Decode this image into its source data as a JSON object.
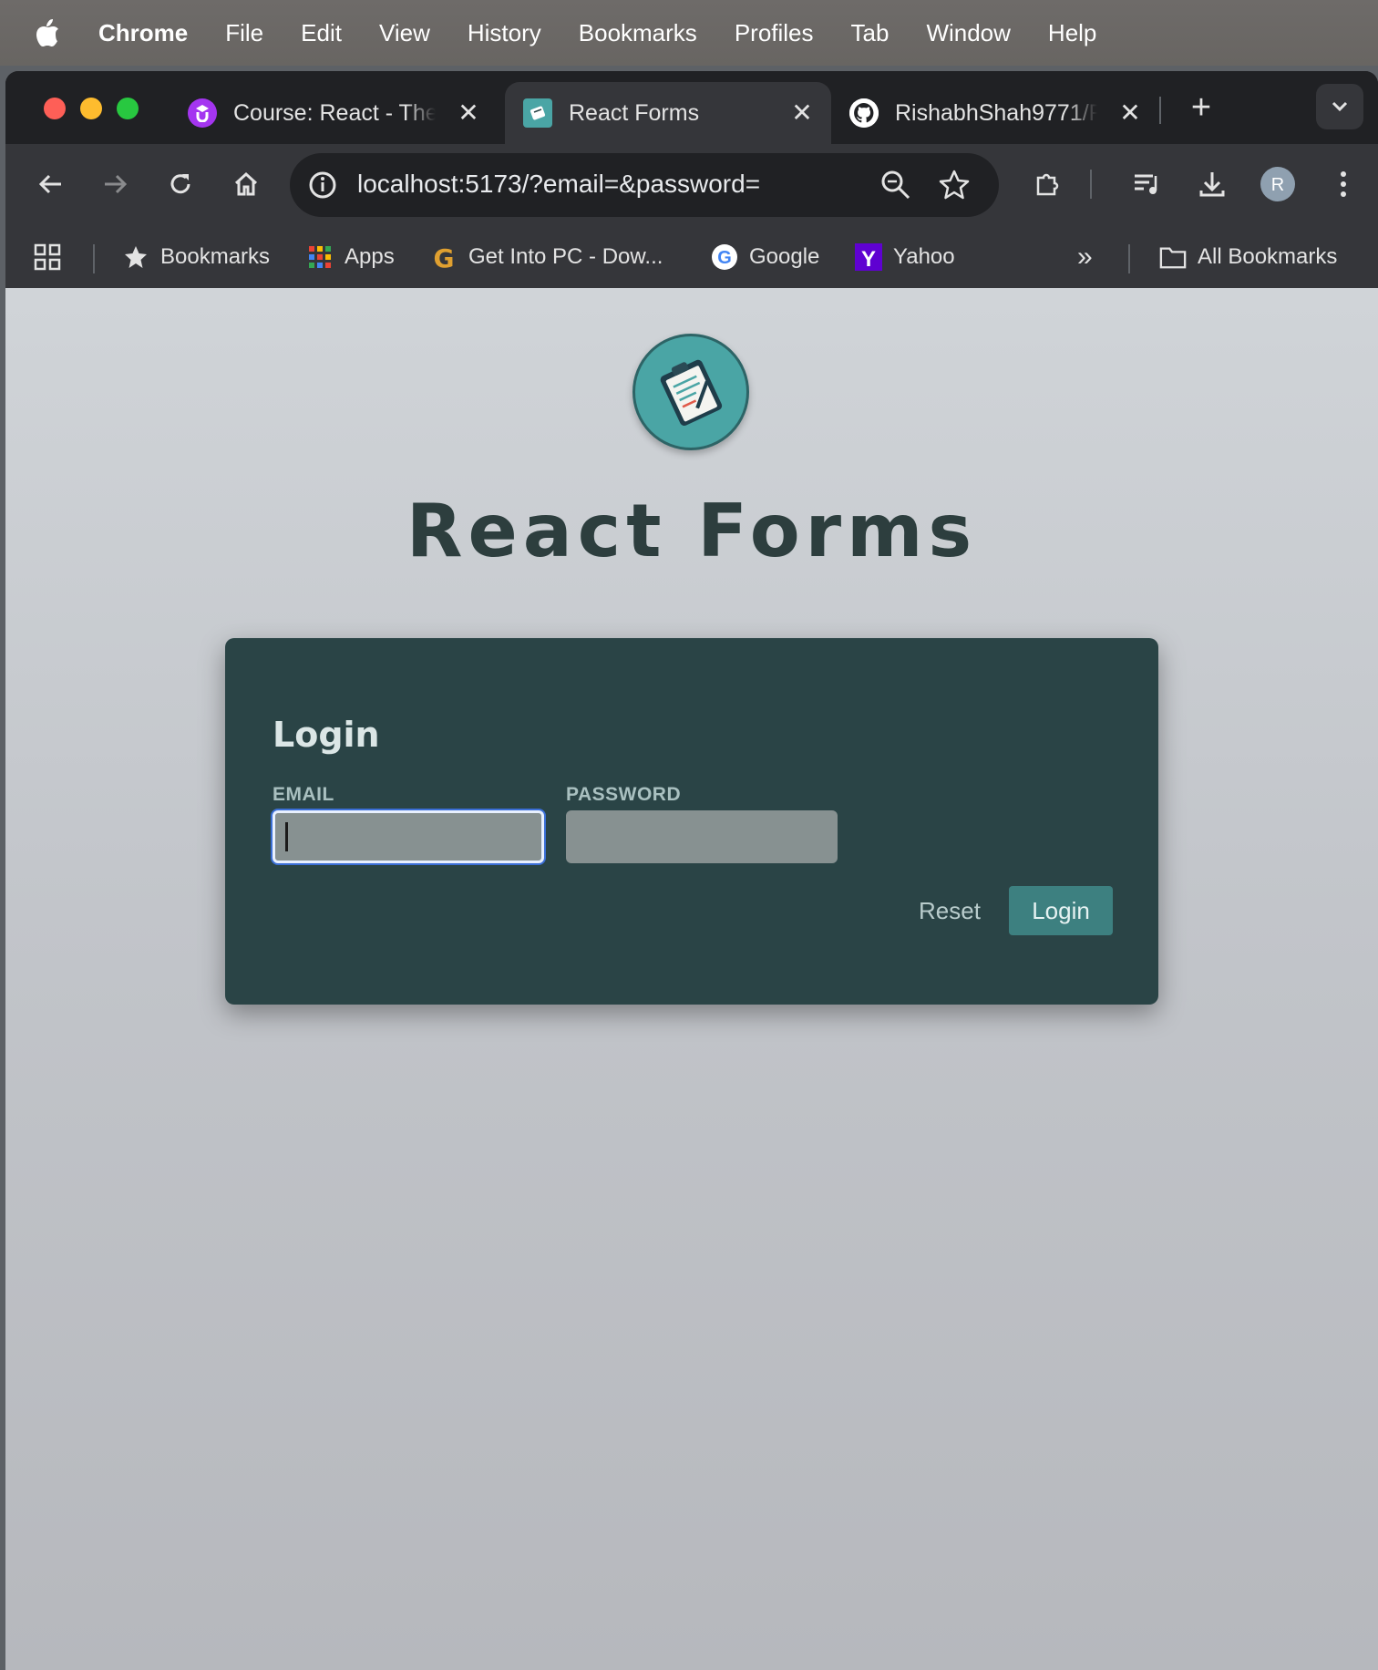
{
  "menubar": {
    "app_name": "Chrome",
    "items": [
      "File",
      "Edit",
      "View",
      "History",
      "Bookmarks",
      "Profiles",
      "Tab",
      "Window",
      "Help"
    ]
  },
  "tabs": [
    {
      "title": "Course: React - The",
      "favicon": "udemy-icon",
      "active": false
    },
    {
      "title": "React Forms",
      "favicon": "react-forms-icon",
      "active": true
    },
    {
      "title": "RishabhShah9771/R",
      "favicon": "github-icon",
      "active": false
    }
  ],
  "toolbar": {
    "url_host": "localhost",
    "url_rest": ":5173/?email=&password=",
    "avatar_letter": "R"
  },
  "bookmarks_bar": {
    "items": [
      {
        "label": "Bookmarks",
        "icon": "star-icon"
      },
      {
        "label": "Apps",
        "icon": "apps-grid-icon"
      },
      {
        "label": "Get Into PC - Dow...",
        "icon": "getintopc-icon"
      },
      {
        "label": "Google",
        "icon": "google-icon"
      },
      {
        "label": "Yahoo",
        "icon": "yahoo-icon"
      }
    ],
    "overflow_label": "»",
    "all_bookmarks": "All Bookmarks"
  },
  "page": {
    "title": "React Forms",
    "form": {
      "heading": "Login",
      "email_label": "EMAIL",
      "email_value": "",
      "password_label": "PASSWORD",
      "password_value": "",
      "reset_label": "Reset",
      "login_label": "Login"
    }
  },
  "colors": {
    "card_bg": "#2a4446",
    "accent": "#3d8080",
    "title_text": "#2d3e3e"
  }
}
